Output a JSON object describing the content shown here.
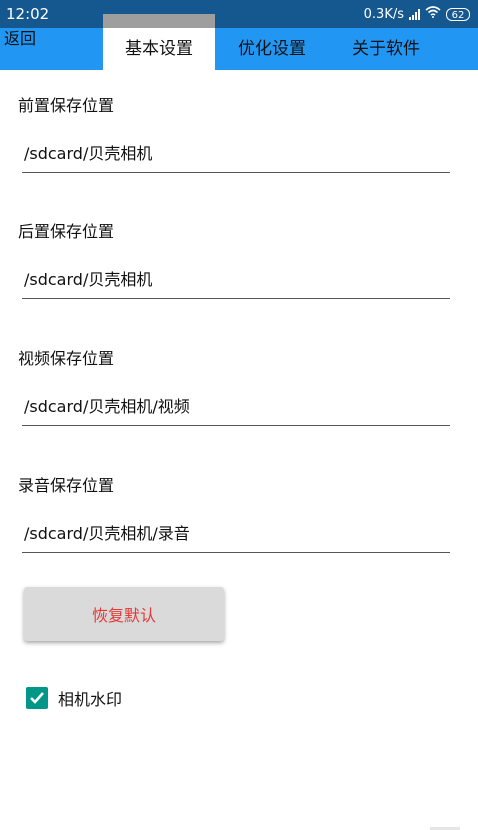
{
  "status_bar": {
    "time": "12:02",
    "network_speed": "0.3K/s",
    "battery": "62",
    "icons": [
      "signal-icon",
      "wifi-icon",
      "battery-icon"
    ]
  },
  "header": {
    "back_label": "返回",
    "tabs": [
      {
        "label": "基本设置",
        "active": true
      },
      {
        "label": "优化设置",
        "active": false
      },
      {
        "label": "关于软件",
        "active": false
      }
    ]
  },
  "settings": {
    "front_path": {
      "label": "前置保存位置",
      "value": "/sdcard/贝壳相机"
    },
    "rear_path": {
      "label": "后置保存位置",
      "value": "/sdcard/贝壳相机"
    },
    "video_path": {
      "label": "视频保存位置",
      "value": "/sdcard/贝壳相机/视频"
    },
    "audio_path": {
      "label": "录音保存位置",
      "value": "/sdcard/贝壳相机/录音"
    }
  },
  "reset_button_label": "恢复默认",
  "watermark": {
    "label": "相机水印",
    "checked": true
  },
  "colors": {
    "status_bar": "#15578f",
    "app_bar": "#2196f3",
    "accent": "#009688",
    "reset_text": "#e53935"
  }
}
